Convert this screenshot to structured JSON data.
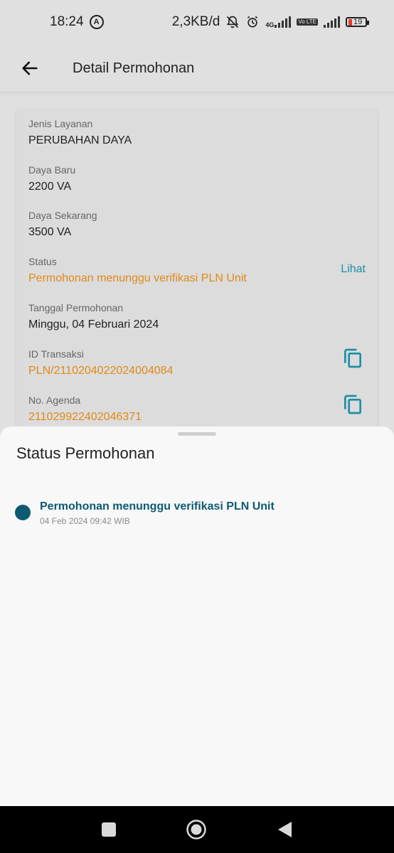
{
  "status_bar": {
    "time": "18:24",
    "auto_indicator": "A",
    "net_speed": "2,3KB/d",
    "network_type": "4G",
    "volte": "Vo LTE",
    "battery_level": "19"
  },
  "app_bar": {
    "title": "Detail Permohonan",
    "back_icon": "arrow-left-icon"
  },
  "details": {
    "jenis_layanan": {
      "label": "Jenis Layanan",
      "value": "PERUBAHAN DAYA"
    },
    "daya_baru": {
      "label": "Daya Baru",
      "value": "2200 VA"
    },
    "daya_sekarang": {
      "label": "Daya Sekarang",
      "value": "3500 VA"
    },
    "status": {
      "label": "Status",
      "value": "Permohonan menunggu verifikasi PLN Unit",
      "action": "Lihat"
    },
    "tanggal": {
      "label": "Tanggal Permohonan",
      "value": "Minggu, 04 Februari 2024"
    },
    "id_transaksi": {
      "label": "ID Transaksi",
      "value": "PLN/2110204022024004084"
    },
    "no_agenda": {
      "label": "No. Agenda",
      "value": "211029922402046371"
    }
  },
  "sheet": {
    "title": "Status Permohonan",
    "timeline": [
      {
        "title": "Permohonan menunggu verifikasi PLN Unit",
        "time": "04 Feb 2024 09:42 WIB"
      }
    ]
  },
  "colors": {
    "accent_orange": "#e08a17",
    "link_teal": "#1e8ea6",
    "timeline_navy": "#0e5a72"
  }
}
